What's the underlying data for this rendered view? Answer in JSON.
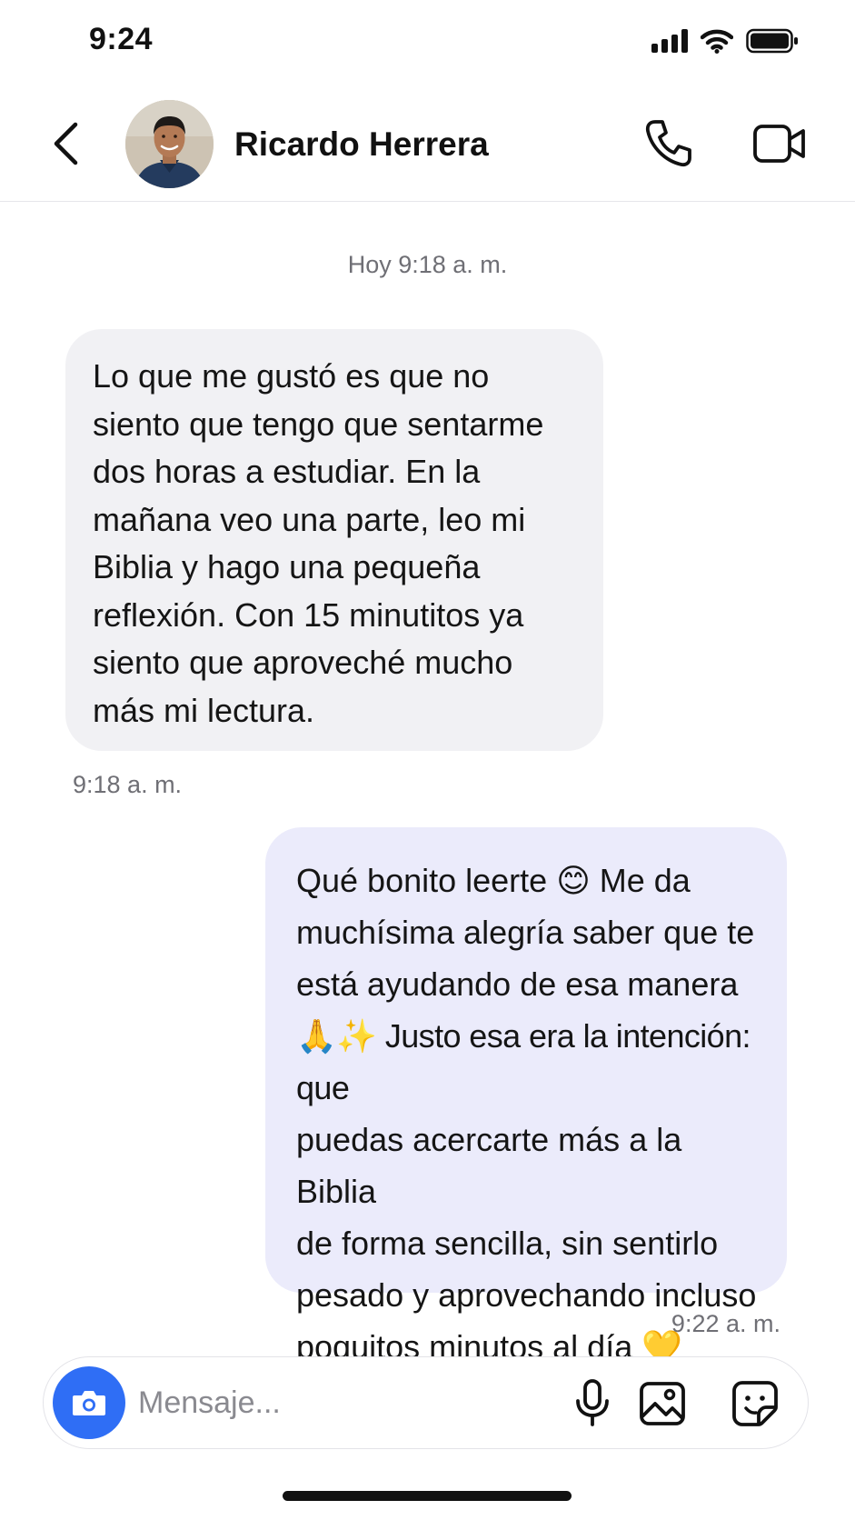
{
  "status_bar": {
    "time": "9:24",
    "icons": [
      "cellular-signal-icon",
      "wifi-icon",
      "battery-icon"
    ]
  },
  "header": {
    "contact_name": "Ricardo Herrera",
    "icons": [
      "back-chevron-icon",
      "avatar-photo",
      "phone-icon",
      "video-camera-icon"
    ]
  },
  "conversation": {
    "date_separator": "Hoy 9:18 a. m.",
    "messages": [
      {
        "direction": "incoming",
        "lines": [
          "Lo que me gustó es que no",
          "siento que tengo que sentarme",
          "dos horas a estudiar. En la",
          "mañana veo una parte, leo mi",
          "Biblia y hago una pequeña",
          "reflexión. Con 15 minutitos ya",
          "siento que aproveché mucho",
          "más mi lectura."
        ],
        "time": "9:18 a. m."
      },
      {
        "direction": "outgoing",
        "lines": [
          "Qué bonito leerte 😊 Me da",
          "muchísima alegría saber que te",
          "está ayudando de esa manera",
          "🙏✨ Justo esa era la intención: que",
          "puedas acercarte más a la Biblia",
          "de forma sencilla, sin sentirlo",
          "pesado y aprovechando incluso",
          "poquitos minutos al día 💛"
        ],
        "time": "9:22 a. m."
      }
    ]
  },
  "composer": {
    "placeholder": "Mensaje...",
    "value": "",
    "icons": [
      "camera-icon",
      "microphone-icon",
      "image-icon",
      "sticker-icon"
    ]
  },
  "colors": {
    "accent_blue": "#2f6ef5",
    "incoming_bubble": "#f1f1f4",
    "outgoing_bubble": "#ebebfb",
    "meta_text": "#6f6f75"
  }
}
